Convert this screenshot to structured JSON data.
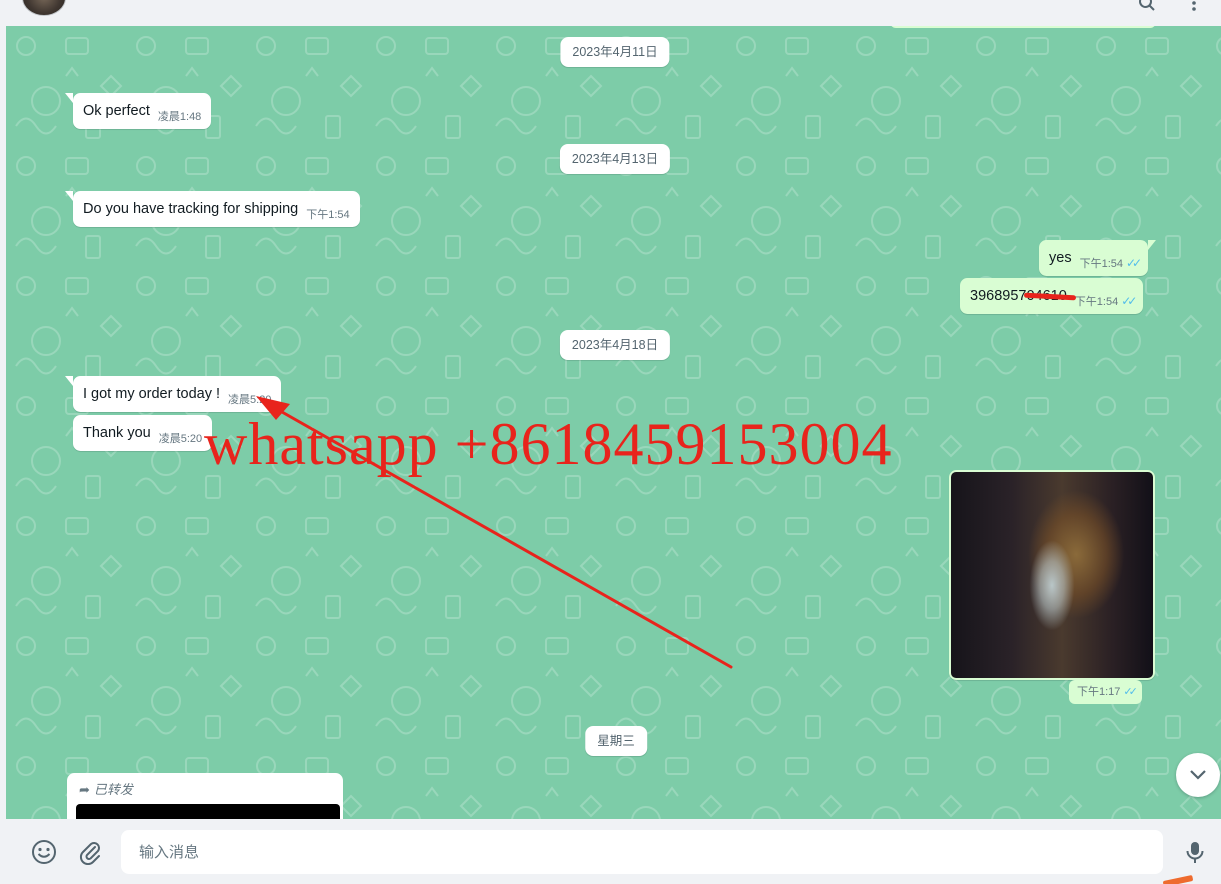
{
  "chat": {
    "date_chips": [
      {
        "label": "2023年4月11日"
      },
      {
        "label": "2023年4月13日"
      },
      {
        "label": "2023年4月18日"
      },
      {
        "label": "星期三"
      }
    ],
    "messages": [
      {
        "text": "Ok perfect",
        "time": "凌晨1:48",
        "direction": "in"
      },
      {
        "text": "Do you have tracking for shipping",
        "time": "下午1:54",
        "direction": "in"
      },
      {
        "text": "yes",
        "time": "下午1:54",
        "direction": "out",
        "status": "read"
      },
      {
        "text": "396895704610",
        "time": "下午1:54",
        "direction": "out",
        "status": "read"
      },
      {
        "text": "I got my order today !",
        "time": "凌晨5:20",
        "direction": "in"
      },
      {
        "text": "Thank you",
        "time": "凌晨5:20",
        "direction": "in"
      }
    ],
    "media_message": {
      "time": "下午1:17",
      "direction": "out",
      "status": "read"
    },
    "forwarded_message": {
      "label": "已转发"
    }
  },
  "overlay": {
    "watermark_text": "whatsapp +8618459153004",
    "annotation_color": "#e8241c"
  },
  "composer": {
    "placeholder": "输入消息"
  },
  "colors": {
    "chat_background": "#7dcca8",
    "incoming_bubble": "#ffffff",
    "outgoing_bubble": "#d9fdd3",
    "read_ticks": "#53bdeb",
    "icon": "#54656f"
  },
  "icons": {
    "emoji": "emoji-icon",
    "attach": "paperclip-icon",
    "mic": "microphone-icon",
    "scroll_down": "chevron-down-icon",
    "forward": "forward-arrow-icon"
  }
}
